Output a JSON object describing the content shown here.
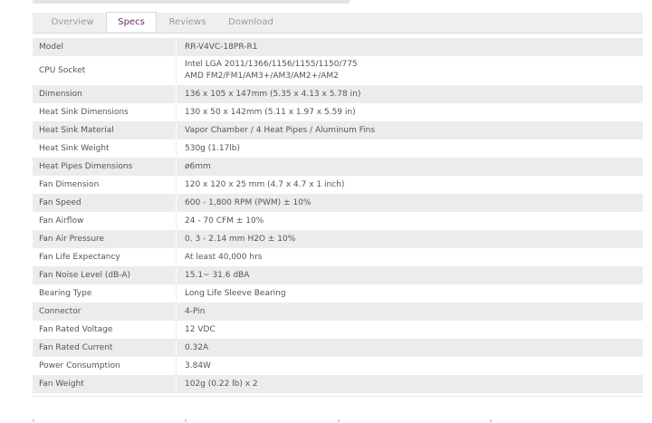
{
  "tabs": [
    {
      "label": "Overview",
      "active": false
    },
    {
      "label": "Specs",
      "active": true
    },
    {
      "label": "Reviews",
      "active": false
    },
    {
      "label": "Download",
      "active": false
    }
  ],
  "specs": [
    {
      "key": "Model",
      "value": [
        "RR-V4VC-18PR-R1"
      ]
    },
    {
      "key": "CPU Socket",
      "value": [
        "Intel LGA 2011/1366/1156/1155/1150/775",
        "AMD FM2/FM1/AM3+/AM3/AM2+/AM2"
      ]
    },
    {
      "key": "Dimension",
      "value": [
        "136 x 105 x 147mm (5.35 x 4.13 x 5.78 in)"
      ]
    },
    {
      "key": "Heat Sink Dimensions",
      "value": [
        "130 x 50 x 142mm (5.11 x 1.97 x 5.59 in)"
      ]
    },
    {
      "key": "Heat Sink Material",
      "value": [
        "Vapor Chamber / 4 Heat Pipes / Aluminum Fins"
      ]
    },
    {
      "key": "Heat Sink Weight",
      "value": [
        "530g (1.17lb)"
      ]
    },
    {
      "key": "Heat Pipes Dimensions",
      "value": [
        "ø6mm"
      ]
    },
    {
      "key": "Fan Dimension",
      "value": [
        "120 x 120 x 25 mm (4.7 x 4.7 x 1 inch)"
      ]
    },
    {
      "key": "Fan Speed",
      "value": [
        "600 - 1,800 RPM (PWM) ± 10%"
      ]
    },
    {
      "key": "Fan Airflow",
      "value": [
        "24 - 70 CFM ± 10%"
      ]
    },
    {
      "key": "Fan Air Pressure",
      "value": [
        "0. 3 - 2.14 mm H2O ± 10%"
      ]
    },
    {
      "key": "Fan Life Expectancy",
      "value": [
        "At least 40,000 hrs"
      ]
    },
    {
      "key": "Fan Noise Level (dB-A)",
      "value": [
        "15.1~ 31.6 dBA"
      ]
    },
    {
      "key": "Bearing Type",
      "value": [
        "Long Life Sleeve Bearing"
      ]
    },
    {
      "key": "Connector",
      "value": [
        "4-Pin"
      ]
    },
    {
      "key": "Fan Rated Voltage",
      "value": [
        "12 VDC"
      ]
    },
    {
      "key": "Fan Rated Current",
      "value": [
        "0.32A"
      ]
    },
    {
      "key": "Power Consumption",
      "value": [
        "3.84W"
      ]
    },
    {
      "key": "Fan Weight",
      "value": [
        "102g (0.22 lb) x 2"
      ]
    }
  ],
  "colors": {
    "active_tab_text": "#6b2c6b",
    "inactive_tab_text": "#9a9a9a",
    "row_shade": "#ececec"
  }
}
